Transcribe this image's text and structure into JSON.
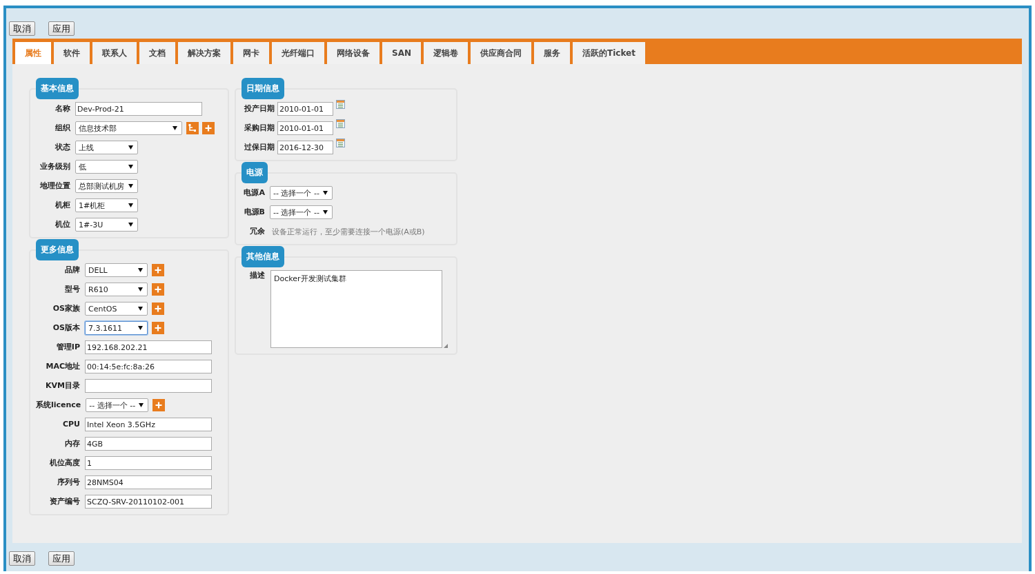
{
  "top_buttons": [
    "取消",
    "应用"
  ],
  "tabs": [
    {
      "label": "属性",
      "selected": true
    },
    {
      "label": "软件",
      "selected": false
    },
    {
      "label": "联系人",
      "selected": false
    },
    {
      "label": "文档",
      "selected": false
    },
    {
      "label": "解决方案",
      "selected": false
    },
    {
      "label": "网卡",
      "selected": false
    },
    {
      "label": "光纤端口",
      "selected": false
    },
    {
      "label": "网络设备",
      "selected": false
    },
    {
      "label": "SAN",
      "selected": false
    },
    {
      "label": "逻辑卷",
      "selected": false
    },
    {
      "label": "供应商合同",
      "selected": false
    },
    {
      "label": "服务",
      "selected": false
    },
    {
      "label": "活跃的Ticket",
      "selected": false
    }
  ],
  "columns": [
    {
      "panels": [
        {
          "title": "基本信息",
          "rows": [
            {
              "label": "名称",
              "kind": "text",
              "value": "Dev-Prod-21"
            },
            {
              "label": "组织",
              "kind": "select",
              "value": "信息技术部",
              "focused": false,
              "tree_button": true,
              "add_button": true
            },
            {
              "label": "状态",
              "kind": "select",
              "value": "上线",
              "focused": false,
              "tree_button": false,
              "add_button": false
            },
            {
              "label": "业务级别",
              "kind": "select",
              "value": "低",
              "focused": false,
              "tree_button": false,
              "add_button": false
            },
            {
              "label": "地理位置",
              "kind": "select",
              "value": "总部测试机房",
              "focused": false,
              "tree_button": false,
              "add_button": false
            },
            {
              "label": "机柜",
              "kind": "select",
              "value": "1#机柜",
              "focused": false,
              "tree_button": false,
              "add_button": false
            },
            {
              "label": "机位",
              "kind": "select",
              "value": "1#-3U",
              "focused": false,
              "tree_button": false,
              "add_button": false
            }
          ]
        },
        {
          "title": "更多信息",
          "rows": [
            {
              "label": "品牌",
              "kind": "select",
              "value": "DELL",
              "focused": false,
              "tree_button": false,
              "add_button": true
            },
            {
              "label": "型号",
              "kind": "select",
              "value": "R610",
              "focused": false,
              "tree_button": false,
              "add_button": true
            },
            {
              "label": "OS家族",
              "kind": "select",
              "value": "CentOS",
              "focused": false,
              "tree_button": false,
              "add_button": true
            },
            {
              "label": "OS版本",
              "kind": "select",
              "value": "7.3.1611",
              "focused": true,
              "tree_button": false,
              "add_button": true
            },
            {
              "label": "管理IP",
              "kind": "text",
              "value": "192.168.202.21"
            },
            {
              "label": "MAC地址",
              "kind": "text",
              "value": "00:14:5e:fc:8a:26"
            },
            {
              "label": "KVM目录",
              "kind": "text",
              "value": ""
            },
            {
              "label": "系统licence",
              "kind": "select",
              "value": "-- 选择一个 --",
              "focused": false,
              "tree_button": false,
              "add_button": true
            },
            {
              "label": "CPU",
              "kind": "text",
              "value": "Intel Xeon 3.5GHz"
            },
            {
              "label": "内存",
              "kind": "text",
              "value": "4GB"
            },
            {
              "label": "机位高度",
              "kind": "text",
              "value": "1"
            },
            {
              "label": "序列号",
              "kind": "text",
              "value": "28NMS04"
            },
            {
              "label": "资产编号",
              "kind": "text",
              "value": "SCZQ-SRV-20110102-001"
            }
          ]
        }
      ]
    },
    {
      "panels": [
        {
          "title": "日期信息",
          "rows": [
            {
              "label": "投产日期",
              "kind": "date",
              "value": "2010-01-01"
            },
            {
              "label": "采购日期",
              "kind": "date",
              "value": "2010-01-01"
            },
            {
              "label": "过保日期",
              "kind": "date",
              "value": "2016-12-30"
            }
          ]
        },
        {
          "title": "电源",
          "rows": [
            {
              "label": "电源A",
              "kind": "select",
              "value": "-- 选择一个 --",
              "focused": false,
              "tree_button": false,
              "add_button": false
            },
            {
              "label": "电源B",
              "kind": "select",
              "value": "-- 选择一个 --",
              "focused": false,
              "tree_button": false,
              "add_button": false
            },
            {
              "label": "冗余",
              "kind": "note",
              "value": "设备正常运行，至少需要连接一个电源(A或B)"
            }
          ]
        },
        {
          "title": "其他信息",
          "rows": [
            {
              "label": "描述",
              "kind": "textarea",
              "value": "Docker开发测试集群"
            }
          ]
        }
      ]
    }
  ],
  "bottom_buttons": [
    "取消",
    "应用"
  ]
}
